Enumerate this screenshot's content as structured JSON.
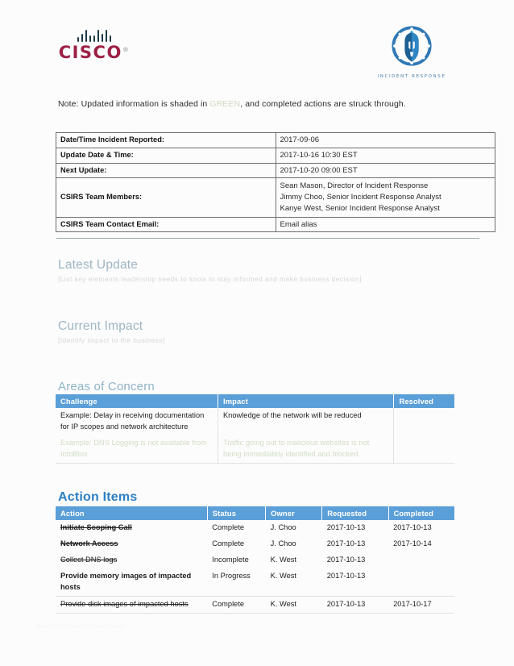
{
  "header": {
    "cisco_wordmark": "CISCO",
    "cisco_trademark": "®",
    "ir_caption": "INCIDENT RESPONSE"
  },
  "note": {
    "before": "Note: Updated information is shaded in ",
    "highlight": "GREEN",
    "after": ", and completed actions are struck through.",
    "highlight_color": "#cfd9c2"
  },
  "info_table": {
    "rows": [
      {
        "label": "Date/Time Incident Reported:",
        "value": "2017-09-06"
      },
      {
        "label": "Update Date & Time:",
        "value": "2017-10-16 10:30 EST"
      },
      {
        "label": "Next Update:",
        "value": "2017-10-20 09:00 EST"
      }
    ],
    "members_label": "CSIRS Team Members:",
    "members": [
      "Sean Mason, Director of Incident Response",
      "Jimmy Choo, Senior Incident Response Analyst",
      "Kanye West, Senior Incident Response Analyst"
    ],
    "email_label": "CSIRS Team Contact Email:",
    "email_value": "Email alias"
  },
  "sections": {
    "latest_update": {
      "heading": "Latest Update",
      "placeholder": "[List key elements leadership needs to know to stay informed and make business decision]"
    },
    "current_impact": {
      "heading": "Current Impact",
      "placeholder": "[Identify impact to the business]"
    },
    "areas_of_concern": {
      "heading": "Areas of Concern"
    },
    "action_items": {
      "heading": "Action Items"
    }
  },
  "concern_table": {
    "headers": [
      "Challenge",
      "Impact",
      "Resolved"
    ],
    "header_color": "#5b9fd8",
    "rows": [
      {
        "challenge": "Example: Delay in receiving documentation for IP scopes and network architecture",
        "impact": "Knowledge of the network will be reduced",
        "resolved": "",
        "style": "normal"
      },
      {
        "challenge": "Example:  DNS Logging is not available from IntoBlox",
        "impact": "Traffic going out to malicious websites is not being immediately identified and blocked",
        "resolved": "",
        "style": "green"
      }
    ]
  },
  "action_table": {
    "headers": [
      "Action",
      "Status",
      "Owner",
      "Requested",
      "Completed"
    ],
    "header_color": "#5b9fd8",
    "rows": [
      {
        "action": "Initiate Scoping Call",
        "status": "Complete",
        "owner": "J. Choo",
        "requested": "2017-10-13",
        "completed": "2017-10-13",
        "action_style": "black-strike-bold",
        "status_style": "status"
      },
      {
        "action": "Network Access",
        "status": "Complete",
        "owner": "J. Choo",
        "requested": "2017-10-13",
        "completed": "2017-10-14",
        "action_style": "black-strike-bold",
        "status_style": "status"
      },
      {
        "action": "Collect DNS logs",
        "status": "Incomplete",
        "owner": "K. West",
        "requested": "2017-10-13",
        "completed": "",
        "action_style": "green-strike",
        "status_style": "status-faint"
      },
      {
        "action": "Provide memory images of impacted hosts",
        "status": "In Progress",
        "owner": "K. West",
        "requested": "2017-10-13",
        "completed": "",
        "action_style": "black-bold",
        "status_style": "status"
      },
      {
        "action": "Provide disk images of impacted hosts",
        "status": "Complete",
        "owner": "K. West",
        "requested": "2017-10-13",
        "completed": "2017-10-17",
        "action_style": "green-strike",
        "status_style": "status"
      }
    ]
  },
  "watermark": {
    "text": "www.template.net/business"
  }
}
